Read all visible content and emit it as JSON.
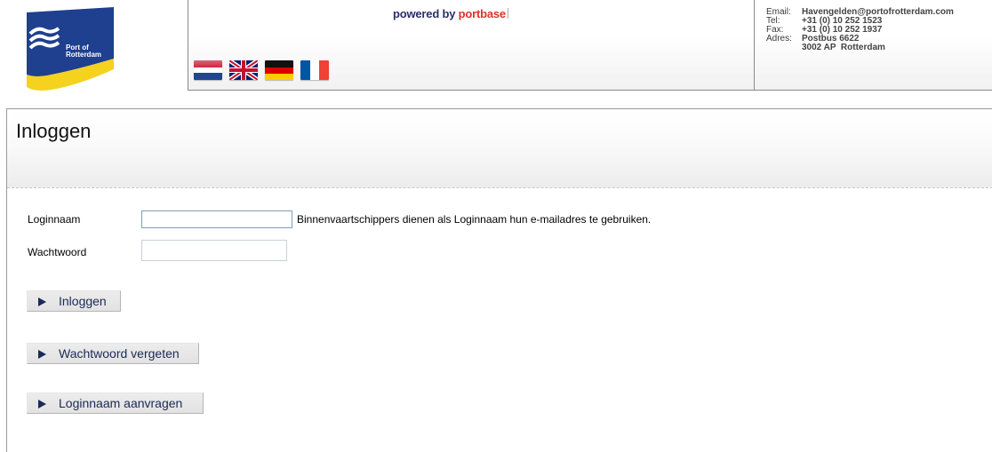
{
  "header": {
    "logo": {
      "line1": "Port of",
      "line2": "Rotterdam",
      "colors": {
        "blue": "#1f3f8f",
        "yellow": "#f4d21e"
      }
    },
    "powered": {
      "prefix": "powered by ",
      "brand": "portbase"
    },
    "languages": [
      {
        "name": "nl-flag-icon",
        "code": "NL"
      },
      {
        "name": "uk-flag-icon",
        "code": "EN"
      },
      {
        "name": "de-flag-icon",
        "code": "DE"
      },
      {
        "name": "fr-flag-icon",
        "code": "FR"
      }
    ],
    "contact": {
      "email_label": "Email:",
      "email_value": "Havengelden@portofrotterdam.com",
      "tel_label": "Tel:",
      "tel_value": "+31 (0) 10 252 1523",
      "fax_label": "Fax:",
      "fax_value": "+31 (0) 10 252 1937",
      "address_label": "Adres:",
      "address_line1": "Postbus 6622",
      "address_line2": "3002 AP  Rotterdam"
    }
  },
  "page": {
    "title": "Inloggen"
  },
  "form": {
    "login_label": "Loginnaam",
    "login_value": "",
    "login_hint": "Binnenvaartschippers dienen als Loginnaam hun e-mailadres te gebruiken.",
    "password_label": "Wachtwoord",
    "password_value": ""
  },
  "buttons": {
    "login": "Inloggen",
    "forgot_password": "Wachtwoord vergeten",
    "request_login": "Loginnaam aanvragen"
  },
  "colors": {
    "accent": "#1b2a56",
    "brand_red": "#e0312a"
  }
}
